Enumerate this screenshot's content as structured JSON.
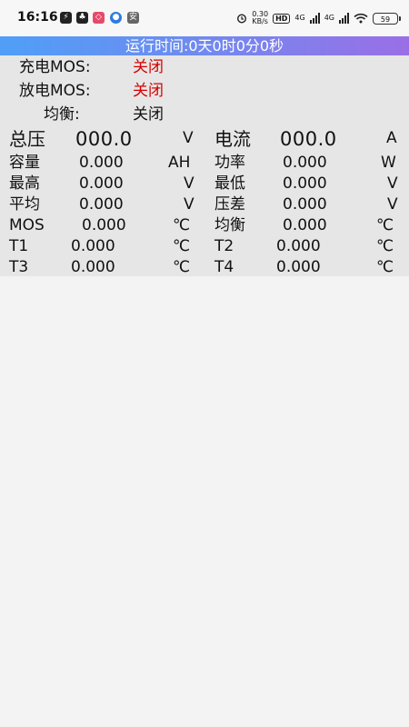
{
  "status_bar": {
    "time": "16:16",
    "apps": [
      {
        "icon": "lightning-app-icon",
        "glyph": "⚡",
        "color": "#222222"
      },
      {
        "icon": "qq-penguin-icon",
        "glyph": "♣",
        "color": "#222222"
      },
      {
        "icon": "pink-app-icon",
        "glyph": "◇",
        "color": "#e64a6a"
      },
      {
        "icon": "blue-app-icon",
        "glyph": "●",
        "color": "#2d7be0"
      },
      {
        "icon": "gray-app-icon",
        "glyph": "安",
        "color": "#666666"
      }
    ],
    "net_speed": "0.30",
    "net_unit": "KB/s",
    "hd_badge": "HD",
    "signal_1": "4G",
    "signal_2": "4G",
    "battery": "59"
  },
  "banner": {
    "runtime_text": "运行时间:0天0时0分0秒"
  },
  "switches": {
    "charge_label": "充电MOS:",
    "charge_value": "关闭",
    "discharge_label": "放电MOS:",
    "discharge_value": "关闭",
    "balance_label": "均衡:",
    "balance_value": "关闭"
  },
  "metrics": {
    "total_voltage": {
      "label": "总压",
      "value": "000.0",
      "unit": "V"
    },
    "current": {
      "label": "电流",
      "value": "000.0",
      "unit": "A"
    },
    "capacity": {
      "label": "容量",
      "value": "0.000",
      "unit": "AH"
    },
    "power": {
      "label": "功率",
      "value": "0.000",
      "unit": "W"
    },
    "highest": {
      "label": "最高",
      "value": "0.000",
      "unit": "V"
    },
    "lowest": {
      "label": "最低",
      "value": "0.000",
      "unit": "V"
    },
    "average": {
      "label": "平均",
      "value": "0.000",
      "unit": "V"
    },
    "voltage_diff": {
      "label": "压差",
      "value": "0.000",
      "unit": "V"
    },
    "mos_temp": {
      "label": "MOS",
      "value": "0.000",
      "unit": "℃"
    },
    "balance_temp": {
      "label": "均衡",
      "value": "0.000",
      "unit": "℃"
    },
    "t1": {
      "label": "T1",
      "value": "0.000",
      "unit": "℃"
    },
    "t2": {
      "label": "T2",
      "value": "0.000",
      "unit": "℃"
    },
    "t3": {
      "label": "T3",
      "value": "0.000",
      "unit": "℃"
    },
    "t4": {
      "label": "T4",
      "value": "0.000",
      "unit": "℃"
    }
  },
  "colors": {
    "off_value": "#d80000",
    "banner_start": "#4f9ff7",
    "banner_end": "#9a6fe6"
  }
}
